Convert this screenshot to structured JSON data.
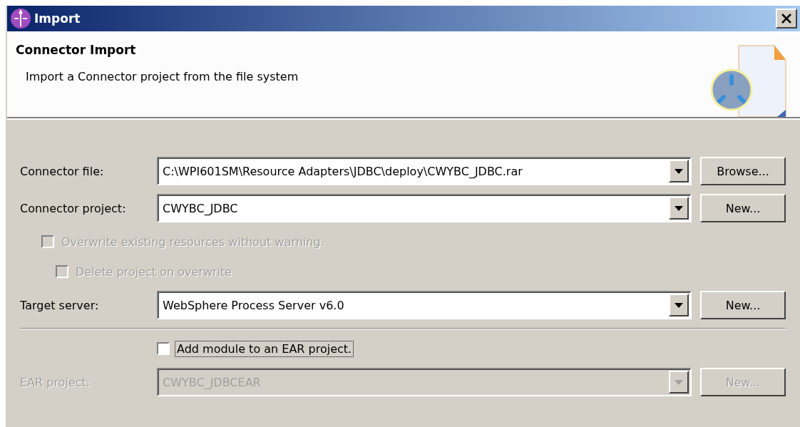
{
  "window": {
    "title": "Import"
  },
  "header": {
    "title": "Connector Import",
    "description": "Import a Connector project from the file system"
  },
  "form": [
    {
      "kind": "combo",
      "label": "Connector file:",
      "value": "C:\\WPI601SM\\Resource Adapters\\JDBC\\deploy\\CWYBC_JDBC.rar",
      "disabled": false,
      "button": {
        "label": "Browse...",
        "disabled": false
      }
    },
    {
      "kind": "combo",
      "label": "Connector project:",
      "value": "CWYBC_JDBC",
      "disabled": false,
      "button": {
        "label": "New...",
        "disabled": false
      }
    },
    {
      "kind": "checkbox",
      "label": "Overwrite existing resources without warning.",
      "checked": false,
      "disabled": true,
      "focused": false,
      "children": [
        {
          "kind": "checkbox",
          "label": "Delete project on overwrite",
          "checked": false,
          "disabled": true,
          "focused": false
        }
      ]
    },
    {
      "kind": "combo",
      "label": "Target server:",
      "value": "WebSphere Process Server v6.0",
      "disabled": false,
      "button": {
        "label": "New...",
        "disabled": false
      }
    },
    {
      "kind": "separator"
    },
    {
      "kind": "checkbox",
      "label": "Add module to an EAR project.",
      "checked": false,
      "disabled": false,
      "focused": true,
      "aligned": true
    },
    {
      "kind": "combo",
      "label": "EAR project:",
      "value": "CWYBC_JDBCEAR",
      "disabled": true,
      "button": {
        "label": "New...",
        "disabled": true
      }
    }
  ]
}
